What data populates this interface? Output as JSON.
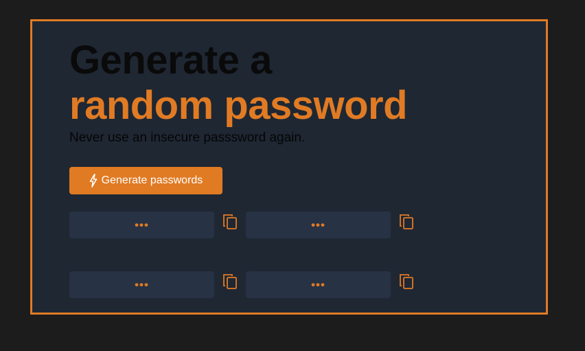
{
  "hero": {
    "title_line1": "Generate a",
    "title_line2": "random password",
    "subtitle": "Never use an insecure passsword again."
  },
  "generate_button": {
    "label": "Generate passwords",
    "icon": "lightning-bolt-icon"
  },
  "passwords": [
    {
      "value": "•••",
      "copy_icon": "copy-icon"
    },
    {
      "value": "•••",
      "copy_icon": "copy-icon"
    },
    {
      "value": "•••",
      "copy_icon": "copy-icon"
    },
    {
      "value": "•••",
      "copy_icon": "copy-icon"
    }
  ],
  "colors": {
    "page_background": "#1c1c1c",
    "card_background": "#1f2733",
    "accent": "#e07b24",
    "field_background": "#273245",
    "title_primary": "#0a0a0a"
  }
}
